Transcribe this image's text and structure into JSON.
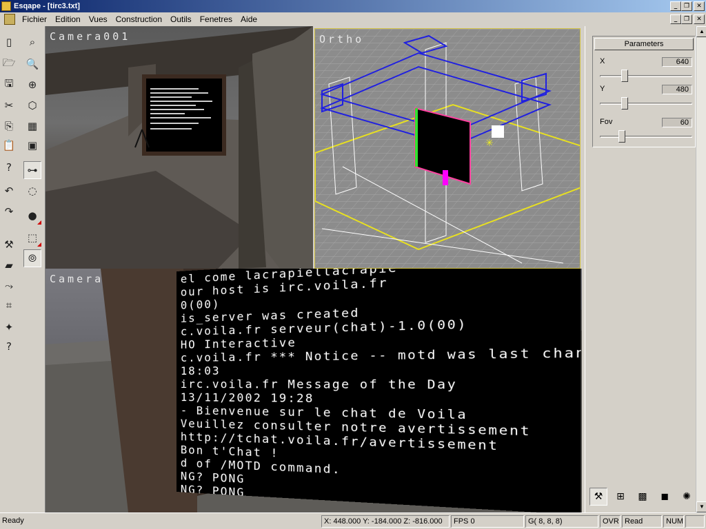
{
  "window": {
    "title": "Esqape - [tirc3.txt]"
  },
  "menu": [
    "Fichier",
    "Edition",
    "Vues",
    "Construction",
    "Outils",
    "Fenetres",
    "Aide"
  ],
  "viewports": {
    "cam001": {
      "label": "Camera001"
    },
    "ortho": {
      "label": "Ortho"
    },
    "camera": {
      "label": "Camera"
    }
  },
  "screen_text": [
    "el come      lacrapiellacrapie",
    "our  host  is  irc.voila.fr",
    "0(00)",
    "is_server   was  created",
    "c.voila.fr   serveur(chat)-1.0(00)",
    "HO  Interactive",
    "c.voila.fr  ***  Notice -- motd was last changed",
    "18:03",
    "irc.voila.fr  Message of the Day",
    "13/11/2002  19:28",
    "- Bienvenue sur le chat de Voila",
    "Veuillez consulter notre avertissement",
    "http://tchat.voila.fr/avertissement",
    "Bon t'Chat !",
    "d of /MOTD command.",
    "NG? PONG",
    "NG? PONG"
  ],
  "parameters": {
    "title": "Parameters",
    "x": {
      "label": "X",
      "value": "640",
      "fraction": 0.25
    },
    "y": {
      "label": "Y",
      "value": "480",
      "fraction": 0.25
    },
    "fov": {
      "label": "Fov",
      "value": "60",
      "fraction": 0.22
    }
  },
  "status": {
    "ready": "Ready",
    "coords": "X: 448.000 Y: -184.000 Z: -816.000",
    "fps": "FPS 0",
    "grid": "G( 8, 8, 8)",
    "ovr": "OVR",
    "read": "Read",
    "num": "NUM"
  }
}
